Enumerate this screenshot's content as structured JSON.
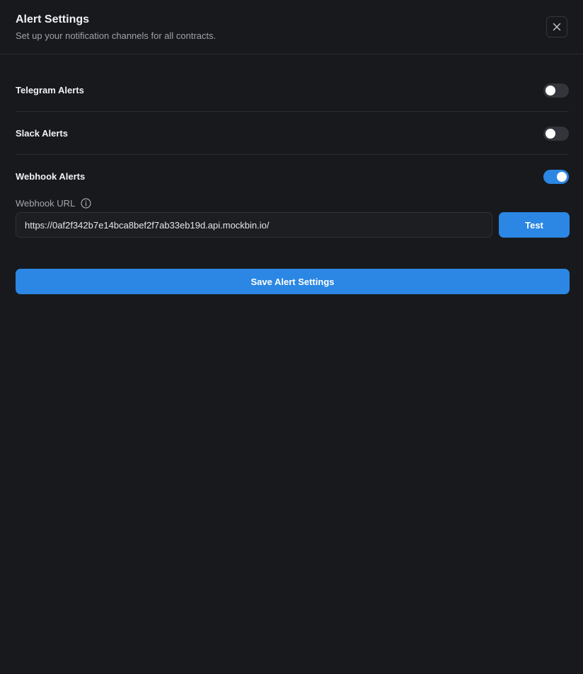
{
  "dialog": {
    "title": "Alert Settings",
    "subtitle": "Set up your notification channels for all contracts.",
    "close_icon": "close-icon"
  },
  "channels": [
    {
      "label": "Telegram Alerts",
      "enabled": false
    },
    {
      "label": "Slack Alerts",
      "enabled": false
    },
    {
      "label": "Webhook Alerts",
      "enabled": true
    }
  ],
  "webhook": {
    "field_label": "Webhook URL",
    "info_icon": "info-icon",
    "url_value": "https://0af2f342b7e14bca8bef2f7ab33eb19d.api.mockbin.io/",
    "test_label": "Test"
  },
  "save_label": "Save Alert Settings",
  "colors": {
    "background": "#18191d",
    "accent": "#2b87e3",
    "toggle_off": "#33353b",
    "divider": "#2a2c31"
  }
}
